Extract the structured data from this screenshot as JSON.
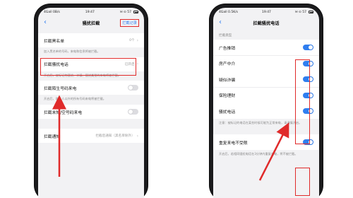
{
  "left": {
    "status": {
      "left": "4Gall 0B/s",
      "time": "19:47",
      "right": "✉ ⊙ 57"
    },
    "nav": {
      "back": "‹",
      "title": "骚扰拦截",
      "link": "拦截记录"
    },
    "blacklist": {
      "label": "拦截黑名单",
      "value": "0个",
      "desc": "加入黑名单的号码，来电和信息将被拦截。"
    },
    "harass": {
      "label": "拦截骚扰电话",
      "value": "已开启",
      "desc": "开启后，被标记为骚扰、诈骗、骚扰类型的来电将被拦截。"
    },
    "stranger": {
      "label": "拦截陌生号码来电",
      "desc": "开启后，联系人以外的所有号码来电将被拦截。"
    },
    "unknown": {
      "label": "拦截未知/空号码来电"
    },
    "notify": {
      "label": "拦截通知",
      "value": "拦截后通知（黑名单除外）"
    }
  },
  "right": {
    "status": {
      "left": "4Gall 0.5K/s",
      "time": "19:47",
      "right": "✉ ⊙ 57"
    },
    "nav": {
      "back": "‹",
      "title": "拦截骚扰电话"
    },
    "section": "拦截类型",
    "types": [
      {
        "label": "广告推销",
        "on": true
      },
      {
        "label": "房产中介",
        "on": true
      },
      {
        "label": "疑似诈骗",
        "on": true
      },
      {
        "label": "保险理财",
        "on": true
      },
      {
        "label": "骚扰电话",
        "on": true
      }
    ],
    "types_desc": "注意：被标记的电话在某些时候可能为正常来电，请谨慎开启。",
    "repeat": {
      "label": "重复来电不受限",
      "on": true,
      "desc": "开启后，若相同骚扰电话在3分钟内重复来电，将不被拦截。"
    }
  },
  "colors": {
    "accent": "#2f7ef0",
    "highlight": "#e02a2a"
  }
}
